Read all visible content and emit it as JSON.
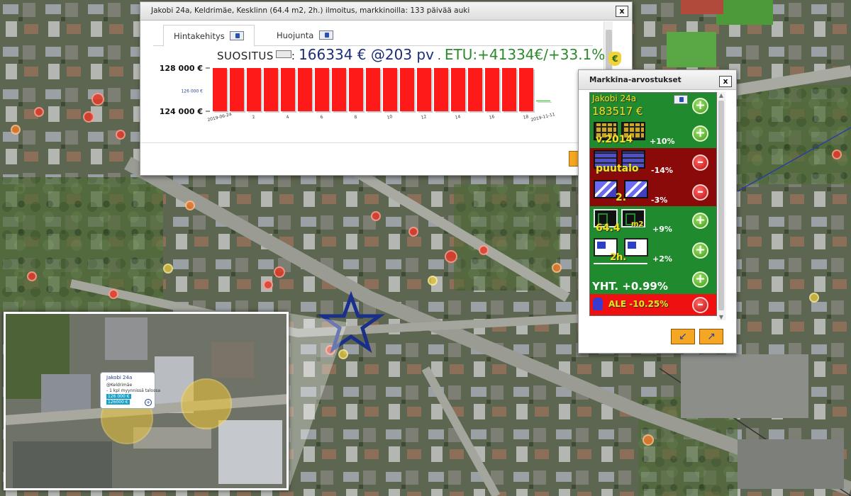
{
  "listing": {
    "title": "Jakobi 24a, Keldrimäe, Kesklinn (64.4 m2, 2h.) ilmoitus, markkinoilla: 133 päivää auki",
    "close": "x",
    "tabs": [
      {
        "label": "Hintakehitys",
        "icon": "chart-icon"
      },
      {
        "label": "Huojunta",
        "icon": "chart-icon"
      }
    ],
    "recommendation": {
      "label": "SUOSITUS",
      "sep": ":",
      "value": "166334 € @203 pv",
      "dot": ".",
      "advantage": "ETU:+41334€/+33.1%",
      "bag": "€"
    }
  },
  "chart_data": {
    "type": "bar",
    "y_tick_labels": [
      "128 000 €",
      "126 000 €",
      "124 000 €"
    ],
    "y_ticks": [
      128000,
      126000,
      124000
    ],
    "ylim": [
      124000,
      128000
    ],
    "x_tick_labels": [
      "2019-06-24",
      "2",
      "4",
      "6",
      "8",
      "10",
      "12",
      "14",
      "16",
      "18",
      "2019-11-11"
    ],
    "categories": [
      "2019-06-24",
      "1",
      "2",
      "3",
      "4",
      "5",
      "6",
      "7",
      "8",
      "9",
      "10",
      "11",
      "12",
      "13",
      "14",
      "15",
      "16",
      "17",
      "18",
      "2019-11-11"
    ],
    "values": [
      128000,
      128000,
      128000,
      128000,
      128000,
      128000,
      128000,
      128000,
      128000,
      128000,
      128000,
      128000,
      128000,
      128000,
      128000,
      128000,
      128000,
      128000,
      128000,
      125000
    ],
    "bar_colors": [
      "#ff1a1a",
      "#ff1a1a",
      "#ff1a1a",
      "#ff1a1a",
      "#ff1a1a",
      "#ff1a1a",
      "#ff1a1a",
      "#ff1a1a",
      "#ff1a1a",
      "#ff1a1a",
      "#ff1a1a",
      "#ff1a1a",
      "#ff1a1a",
      "#ff1a1a",
      "#ff1a1a",
      "#ff1a1a",
      "#ff1a1a",
      "#ff1a1a",
      "#ff1a1a",
      "#2fc82f"
    ],
    "title": "",
    "xlabel": "",
    "ylabel": ""
  },
  "valuation": {
    "title": "Markkina-arvostukset",
    "close": "x",
    "address": "Jakobi 24a",
    "price": "183517 €",
    "items": [
      {
        "label": "v.2014",
        "percent": "+10%",
        "icon": "calendar-icon"
      },
      {
        "label": "puutalo",
        "percent": "-14%",
        "icon": "brick-wall-icon"
      },
      {
        "label": "2.",
        "percent": "-3%",
        "icon": "staircase-icon"
      },
      {
        "label": "64.4",
        "unit": "m2",
        "percent": "+9%",
        "icon": "floorplan-icon"
      },
      {
        "label": "2h.",
        "percent": "+2%",
        "icon": "rooms-icon"
      }
    ],
    "total": "YHT. +0.99%",
    "discount": "ALE -10.25%",
    "plus": "+",
    "minus": "–",
    "collapse_icon": "↙",
    "expand_icon": "↗"
  },
  "inset": {
    "popup_title": "Jakobi 24a",
    "popup_line1": "@Keldrimäe",
    "popup_line2": "- 1 kpl myynnissä talossa",
    "popup_line3": "126 000 €",
    "popup_line4": "126000 €"
  },
  "colors": {
    "accent_orange": "#f5a623",
    "valuation_green": "#1f8a2e",
    "valuation_red": "#8a0a0a",
    "star": "#1a2f8a"
  }
}
